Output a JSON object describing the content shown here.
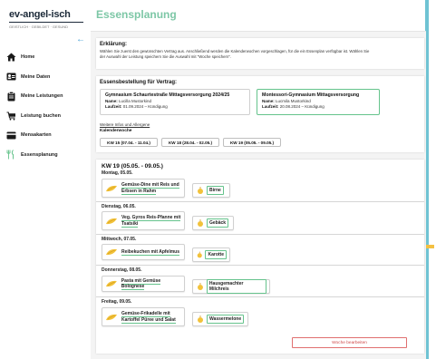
{
  "logo": {
    "text": "ev-angel-isch",
    "subtitle": "GEISTLICH · GEBILDET · GESUND"
  },
  "page_title": "Essensplanung",
  "sidebar": {
    "items": [
      {
        "label": "Home",
        "icon": "home-icon"
      },
      {
        "label": "Meine Daten",
        "icon": "id-card-icon"
      },
      {
        "label": "Meine Leistungen",
        "icon": "clipboard-icon"
      },
      {
        "label": "Leistung buchen",
        "icon": "cart-icon"
      },
      {
        "label": "Mensakarten",
        "icon": "card-icon"
      },
      {
        "label": "Essensplanung",
        "icon": "cutlery-icon",
        "active": true
      }
    ]
  },
  "explanation": {
    "title": "Erklärung:",
    "text1": "Wählen Sie zuerst den gewünschten Vertrag aus. Anschließend werden die Kalenderwochen vorgeschlagen, für die ein Essenplan verfügbar ist. Wählen Sie",
    "text2": "der Auswahl der Leistung speichern Sie die Auswahl mit \"Woche speichern\"."
  },
  "order": {
    "title": "Essensbestellung für Vertrag:",
    "contracts": [
      {
        "title": "Gymnasium Schaurtestraße Mittagsversorgung 2024/25",
        "name_label": "Name:",
        "name": "Lucilla Mustorkind",
        "term_label": "Laufzeit:",
        "term": "01.09.2024 – Kündigung",
        "selected": false
      },
      {
        "title": "Montessori-Gymnasium Mittagsversorgung",
        "name_label": "Name:",
        "name": "Lucmila Mustorkind",
        "term_label": "Laufzeit:",
        "term": "20.08.2024 – Kündigung",
        "selected": true
      }
    ],
    "more_link": "Weitere Infos und Allergene",
    "calendar_label": "Kalenderwoche",
    "weeks": [
      "KW 15 (07.04. - 11.04.)",
      "KW 18 (28.04. - 02.05.)",
      "KW 19 (05.05. - 09.05.)"
    ]
  },
  "week": {
    "title": "KW 19 (05.05. - 09.05.)",
    "days": [
      {
        "label": "Montag, 05.05.",
        "meal_line1": "Gemüse-Dine mit Reis und",
        "meal_line2": "Erbsen in Rahm",
        "dessert": "Birne"
      },
      {
        "label": "Dienstag, 06.05.",
        "meal_line1": "Veg. Gyros Reis-Pfanne mit",
        "meal_line2": "Tsatsiki",
        "dessert": "Gebäck"
      },
      {
        "label": "Mittwoch, 07.05.",
        "meal_line1": "Reibekuchen mit Apfelmus",
        "meal_line2": "",
        "dessert": "Karotte"
      },
      {
        "label": "Donnerstag, 08.05.",
        "meal_line1": "Pasta mit Gemüse Bolognese",
        "meal_line2": "",
        "dessert": "Hausgemachter Milchreis"
      },
      {
        "label": "Freitag, 09.05.",
        "meal_line1": "Gemüse-Frikadelle mit",
        "meal_line2": "Kartoffel Püree und Salat",
        "dessert": "Wassermelone"
      }
    ],
    "edit_button": "Woche bearbeiten"
  },
  "colors": {
    "accent_green": "#65c38c",
    "title_green": "#7dc7a6",
    "frame_blue": "#6fc3d3",
    "edit_red": "#d04a4a"
  }
}
